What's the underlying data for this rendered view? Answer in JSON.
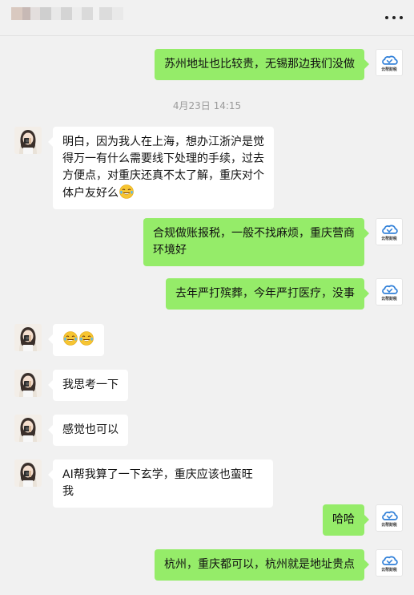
{
  "header": {
    "title_blurred": true,
    "more_icon": "more-dots-icon"
  },
  "colors": {
    "background": "#f1f1f1",
    "my_bubble": "#95ec69",
    "other_bubble": "#ffffff",
    "timestamp": "#9a9a9a"
  },
  "my_avatar_text": "云帮财税",
  "timestamp": "4月23日 14:15",
  "messages": [
    {
      "from": "me",
      "text": "苏州地址也比较贵，无锡那边我们没做"
    },
    {
      "from": "other",
      "text": "明白，因为我人在上海，想办江浙沪是觉得万一有什么需要线下处理的手续，过去方便点，对重庆还真不太了解，重庆对个体户友好么",
      "trailing_emoji": "joy-emoji"
    },
    {
      "from": "me",
      "text": "合规做账报税，一般不找麻烦，重庆营商环境好"
    },
    {
      "from": "me",
      "text": "去年严打殡葬，今年严打医疗，没事"
    },
    {
      "from": "other",
      "text": "",
      "emoji_only": [
        "joy-emoji",
        "joy-emoji"
      ]
    },
    {
      "from": "other",
      "text": "我思考一下"
    },
    {
      "from": "other",
      "text": "感觉也可以"
    },
    {
      "from": "other",
      "text": "AI帮我算了一下玄学，重庆应该也蛮旺我"
    },
    {
      "from": "me",
      "text": "哈哈"
    },
    {
      "from": "me",
      "text": "杭州，重庆都可以，杭州就是地址贵点"
    }
  ]
}
